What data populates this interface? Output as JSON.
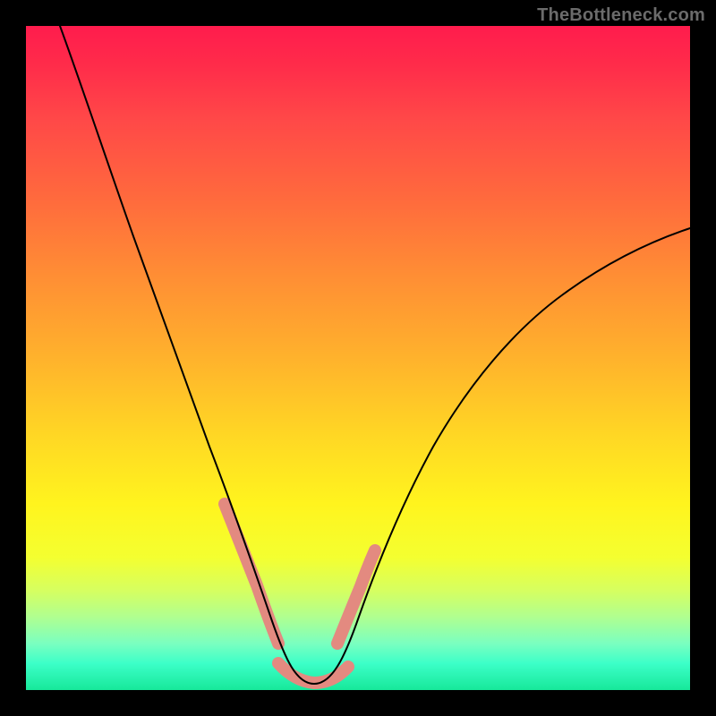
{
  "watermark": {
    "text": "TheBottleneck.com"
  },
  "chart_data": {
    "type": "line",
    "title": "",
    "xlabel": "",
    "ylabel": "",
    "xlim": [
      0,
      100
    ],
    "ylim": [
      0,
      100
    ],
    "grid": false,
    "series": [
      {
        "name": "bottleneck-curve",
        "x": [
          5,
          8,
          12,
          16,
          20,
          24,
          27,
          30,
          32,
          34,
          36,
          38,
          40,
          43,
          46,
          50,
          55,
          60,
          66,
          74,
          82,
          90,
          100
        ],
        "values": [
          100,
          90,
          78,
          66,
          55,
          44,
          36,
          28,
          22,
          16,
          11,
          7,
          4,
          1,
          0,
          1,
          6,
          14,
          24,
          37,
          48,
          57,
          65
        ]
      }
    ],
    "accent_ranges": [
      {
        "where": "left-shoulder",
        "x_start": 30,
        "x_end": 38
      },
      {
        "where": "base",
        "x_start": 38,
        "x_end": 46
      },
      {
        "where": "right-shoulder",
        "x_start": 46,
        "x_end": 52
      }
    ],
    "gradient_stops": [
      {
        "pos": 0.0,
        "color": "#ff1c4d"
      },
      {
        "pos": 0.14,
        "color": "#ff4848"
      },
      {
        "pos": 0.38,
        "color": "#ff8f34"
      },
      {
        "pos": 0.62,
        "color": "#ffd824"
      },
      {
        "pos": 0.8,
        "color": "#f4ff30"
      },
      {
        "pos": 0.93,
        "color": "#7affc0"
      },
      {
        "pos": 1.0,
        "color": "#17e89a"
      }
    ]
  }
}
